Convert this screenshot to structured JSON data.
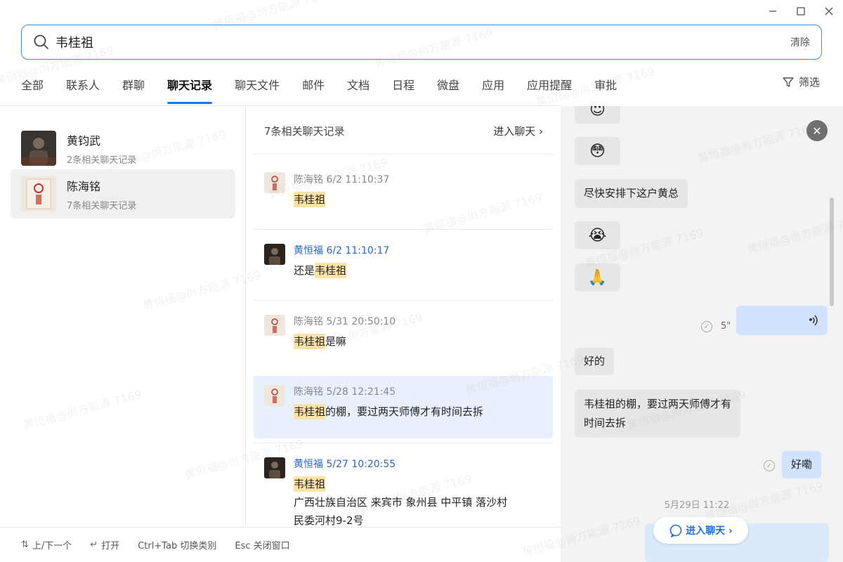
{
  "window": {
    "minimize": "—",
    "maximize": "☐",
    "close": "✕"
  },
  "search": {
    "value": "韦桂祖",
    "clear_label": "清除"
  },
  "tabs": [
    {
      "label": "全部"
    },
    {
      "label": "联系人"
    },
    {
      "label": "群聊"
    },
    {
      "label": "聊天记录",
      "active": true
    },
    {
      "label": "聊天文件"
    },
    {
      "label": "邮件"
    },
    {
      "label": "文档"
    },
    {
      "label": "日程"
    },
    {
      "label": "微盘"
    },
    {
      "label": "应用"
    },
    {
      "label": "应用提醒"
    },
    {
      "label": "审批"
    }
  ],
  "filter_label": "筛选",
  "contacts": [
    {
      "name": "黄钧武",
      "sub": "2条相关聊天记录"
    },
    {
      "name": "陈海铭",
      "sub": "7条相关聊天记录"
    }
  ],
  "middle": {
    "header": "7条相关聊天记录",
    "enter_chat": "进入聊天",
    "messages": [
      {
        "meta": "陈海铭 6/2 11:10:37",
        "pre": "",
        "mark": "韦桂祖",
        "post": "",
        "extra": ""
      },
      {
        "meta": "黄恒福 6/2 11:10:17",
        "pre": "还是",
        "mark": "韦桂祖",
        "post": "",
        "extra": ""
      },
      {
        "meta": "陈海铭 5/31 20:50:10",
        "pre": "",
        "mark": "韦桂祖",
        "post": "是嘛",
        "extra": ""
      },
      {
        "meta": "陈海铭 5/28 12:21:45",
        "pre": "",
        "mark": "韦桂祖",
        "post": "的棚，要过两天师傅才有时间去拆",
        "extra": ""
      },
      {
        "meta": "黄恒福 5/27 10:20:55",
        "pre": "",
        "mark": "韦桂祖",
        "post": "",
        "extra": "广西壮族自治区 来宾市 象州县 中平镇 落沙村",
        "extra2": "民委河村9-2号"
      }
    ]
  },
  "footer": [
    {
      "icon": "⇅",
      "label": "上/下一个"
    },
    {
      "icon": "↵",
      "label": "打开"
    },
    {
      "icon": "",
      "label": "Ctrl+Tab 切换类别"
    },
    {
      "icon": "",
      "label": "Esc 关闭窗口"
    }
  ],
  "right": {
    "close": "✕",
    "bubbles": {
      "emoji1": "😇",
      "emoji2": "😳",
      "text1": "尽快安排下这户黄总",
      "emoji3": "😭",
      "emoji4": "🙏",
      "voice_duration": "5\"",
      "text2": "好的",
      "text3a": "韦桂祖的棚，要过两天师傅才有",
      "text3b": "时间去拆",
      "text4": "好嘞"
    },
    "timestamp": "5月29日 11:22",
    "enter_chat_button": "进入聊天 ›"
  },
  "watermark": "黄恒福@尚方能源 7169"
}
